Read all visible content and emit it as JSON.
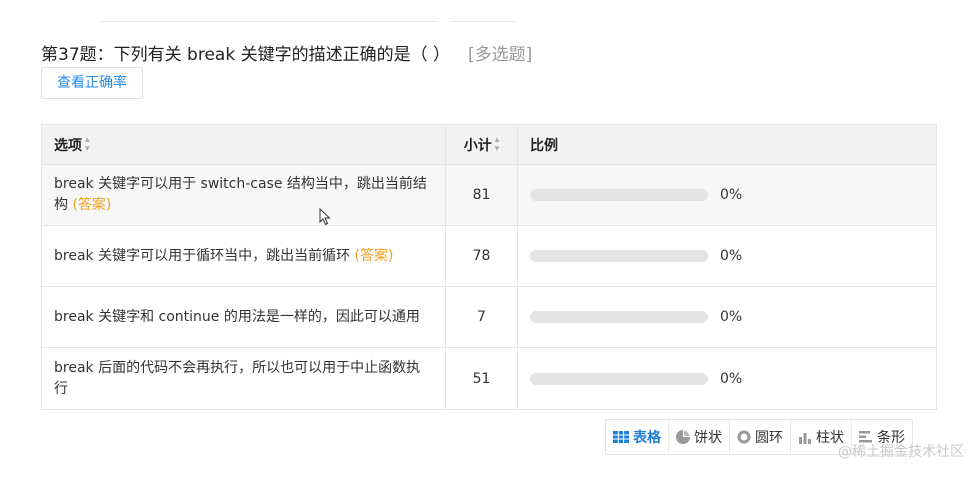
{
  "question": {
    "text": "第37题：下列有关 break 关键字的描述正确的是（ ）",
    "type": "[多选题]"
  },
  "accuracy_button": "查看正确率",
  "table": {
    "headers": {
      "option": "选项",
      "count": "小计",
      "ratio": "比例"
    },
    "rows": [
      {
        "text": "break 关键字可以用于 switch-case 结构当中，跳出当前结构",
        "answer_tag": "(答案)",
        "count": "81",
        "percent_text": "0%",
        "percent_value": 0
      },
      {
        "text": "break 关键字可以用于循环当中，跳出当前循环",
        "answer_tag": "(答案)",
        "count": "78",
        "percent_text": "0%",
        "percent_value": 0
      },
      {
        "text": "break 关键字和 continue 的用法是一样的，因此可以通用",
        "answer_tag": "",
        "count": "7",
        "percent_text": "0%",
        "percent_value": 0
      },
      {
        "text": "break 后面的代码不会再执行，所以也可以用于中止函数执行",
        "answer_tag": "",
        "count": "51",
        "percent_text": "0%",
        "percent_value": 0
      }
    ]
  },
  "view_switch": {
    "table": "表格",
    "pie": "饼状",
    "donut": "圆环",
    "column": "柱状",
    "bar": "条形"
  },
  "watermark": "@稀土掘金技术社区",
  "colors": {
    "accent": "#1e7fd8",
    "answer": "#f0a020",
    "link": "#2a8ae8"
  }
}
